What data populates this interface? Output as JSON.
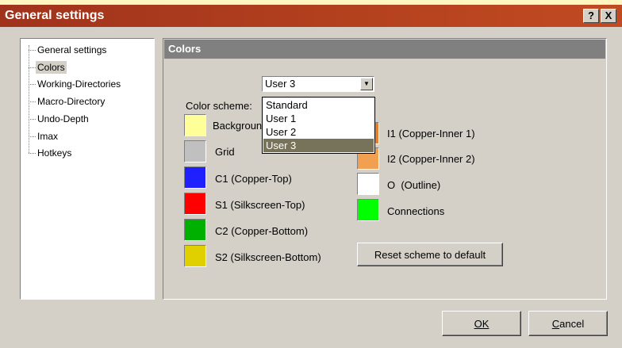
{
  "window": {
    "title": "General settings",
    "help_label": "?",
    "close_label": "X"
  },
  "tree": {
    "items": [
      {
        "label": "General settings",
        "selected": false
      },
      {
        "label": "Colors",
        "selected": true
      },
      {
        "label": "Working-Directories",
        "selected": false
      },
      {
        "label": "Macro-Directory",
        "selected": false
      },
      {
        "label": "Undo-Depth",
        "selected": false
      },
      {
        "label": "Imax",
        "selected": false
      },
      {
        "label": "Hotkeys",
        "selected": false
      }
    ]
  },
  "panel": {
    "title": "Colors"
  },
  "color_scheme": {
    "label": "Color scheme:",
    "value": "User 3",
    "options": [
      "Standard",
      "User 1",
      "User 2",
      "User 3"
    ],
    "selected_option": "User 3"
  },
  "colors_left": [
    {
      "label": "Background",
      "color": "#ffff99"
    },
    {
      "label": "Grid",
      "color": "#c0c0c0"
    },
    {
      "label": "C1 (Copper-Top)",
      "color": "#1f1fff"
    },
    {
      "label": "S1 (Silkscreen-Top)",
      "color": "#ff0000"
    },
    {
      "label": "C2 (Copper-Bottom)",
      "color": "#00b000"
    },
    {
      "label": "S2 (Silkscreen-Bottom)",
      "color": "#e0d000"
    }
  ],
  "colors_right": [
    {
      "label": "I1 (Copper-Inner 1)",
      "color": "#e08030"
    },
    {
      "label": "I2 (Copper-Inner 2)",
      "color": "#f0a050"
    },
    {
      "label": "O  (Outline)",
      "color": "#ffffff"
    },
    {
      "label": "Connections",
      "color": "#00ff00"
    }
  ],
  "buttons": {
    "reset": "Reset scheme to default",
    "ok": "OK",
    "cancel": "Cancel"
  }
}
